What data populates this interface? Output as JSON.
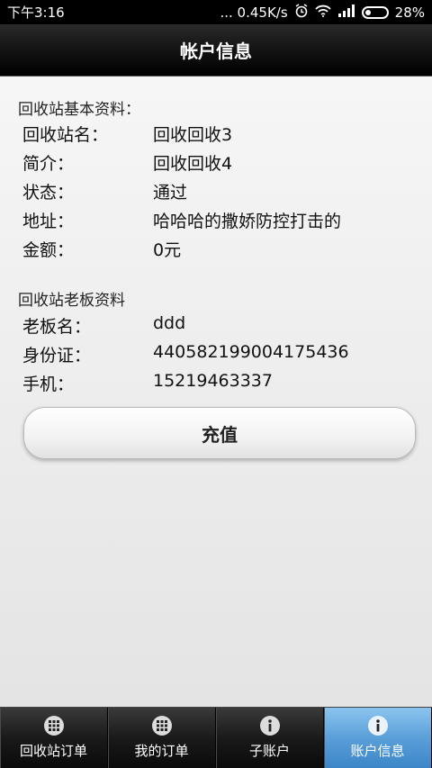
{
  "status_bar": {
    "time": "下午3:16",
    "network_speed": "... 0.45K/s",
    "battery": "28%"
  },
  "header": {
    "title": "帐户信息"
  },
  "station_info": {
    "section_title": "回收站基本资料：",
    "rows": [
      {
        "label": "回收站名：",
        "value": "回收回收3"
      },
      {
        "label": "简介：",
        "value": "回收回收4"
      },
      {
        "label": "状态：",
        "value": "通过"
      },
      {
        "label": "地址：",
        "value": "哈哈哈的撒娇防控打击的"
      },
      {
        "label": "金额：",
        "value": "0元"
      }
    ]
  },
  "owner_info": {
    "section_title": "回收站老板资料",
    "rows": [
      {
        "label": "老板名：",
        "value": "ddd"
      },
      {
        "label": "身份证：",
        "value": "440582199004175436"
      },
      {
        "label": "手机：",
        "value": "15219463337"
      }
    ]
  },
  "actions": {
    "recharge_label": "充值"
  },
  "tabs": [
    {
      "label": "回收站订单",
      "icon": "grid-icon"
    },
    {
      "label": "我的订单",
      "icon": "grid-icon"
    },
    {
      "label": "子账户",
      "icon": "info-icon"
    },
    {
      "label": "账户信息",
      "icon": "info-icon",
      "active": true
    }
  ],
  "colors": {
    "active_tab": "#5a9fd8",
    "title_bar": "#111111"
  }
}
